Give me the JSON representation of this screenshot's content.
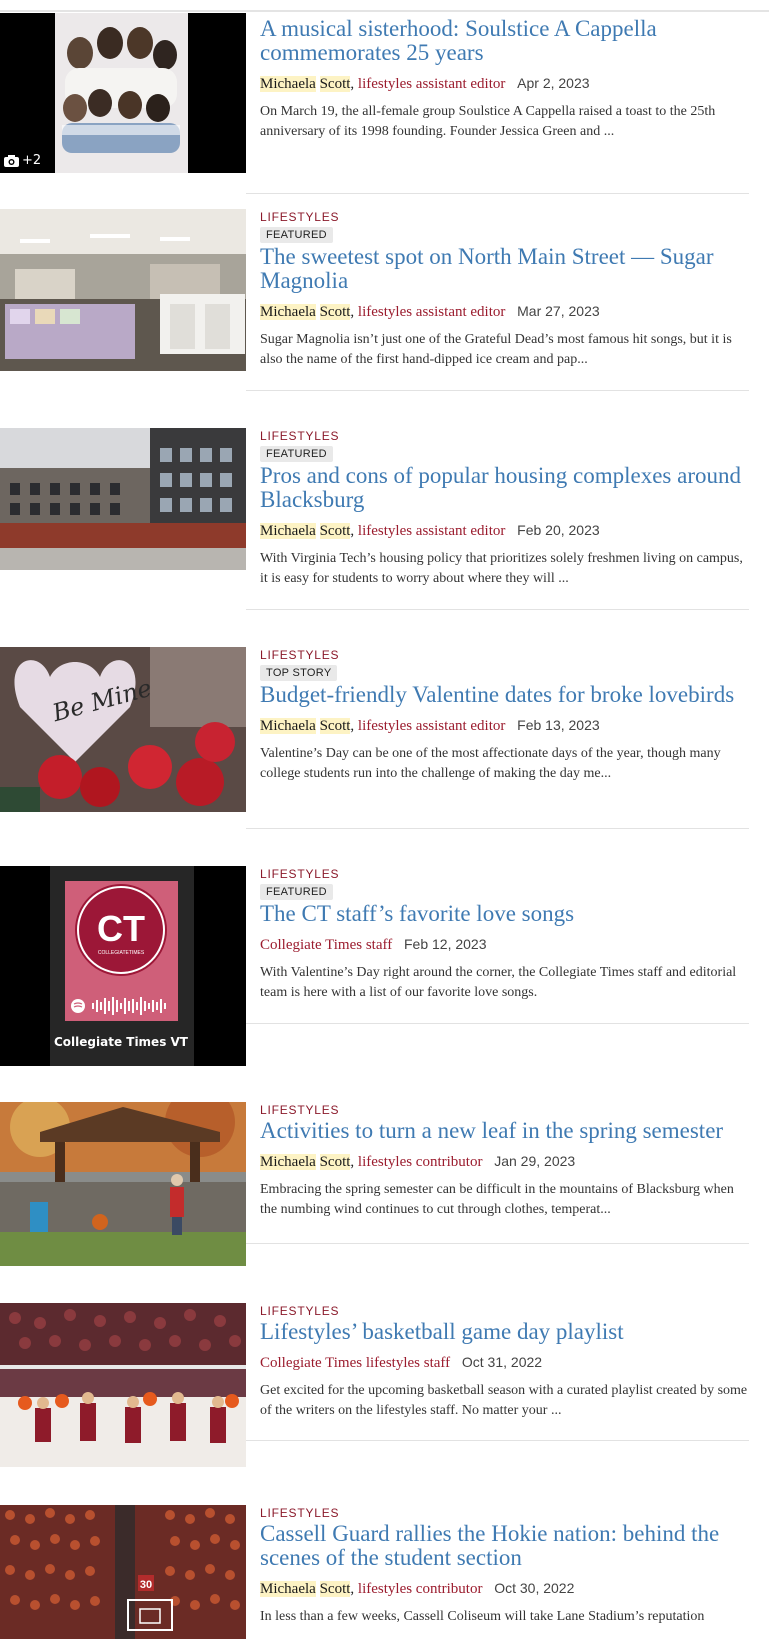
{
  "photo_count": "+2",
  "articles": [
    {
      "section": "",
      "badge": "",
      "headline": "A musical sisterhood: Soulstice A Cappella commemorates 25 years",
      "author_first": "Michaela",
      "author_last": "Scott",
      "author_full": "",
      "role": "lifestyles assistant editor",
      "date": "Apr 2, 2023",
      "excerpt": "On March 19, the all-female group Soulstice A Cappella raised a toast to the 25th anniversary of its 1998 founding. Founder Jessica Green and ..."
    },
    {
      "section": "LIFESTYLES",
      "badge": "FEATURED",
      "headline": "The sweetest spot on North Main Street — Sugar Magnolia",
      "author_first": "Michaela",
      "author_last": "Scott",
      "author_full": "",
      "role": "lifestyles assistant editor",
      "date": "Mar 27, 2023",
      "excerpt": "Sugar Magnolia isn’t just one of the Grateful Dead’s most famous hit songs, but it is also the name of the first hand-dipped ice cream and pap..."
    },
    {
      "section": "LIFESTYLES",
      "badge": "FEATURED",
      "headline": "Pros and cons of popular housing complexes around Blacksburg",
      "author_first": "Michaela",
      "author_last": "Scott",
      "author_full": "",
      "role": "lifestyles assistant editor",
      "date": "Feb 20, 2023",
      "excerpt": "With Virginia Tech’s housing policy that prioritizes solely freshmen living on campus, it is easy for students to worry about where they will ..."
    },
    {
      "section": "LIFESTYLES",
      "badge": "TOP STORY",
      "headline": "Budget-friendly Valentine dates for broke lovebirds",
      "author_first": "Michaela",
      "author_last": "Scott",
      "author_full": "",
      "role": "lifestyles assistant editor",
      "date": "Feb 13, 2023",
      "excerpt": "Valentine’s Day can be one of the most affectionate days of the year, though many college students run into the challenge of making the day me...",
      "image_text": "Be Mine"
    },
    {
      "section": "LIFESTYLES",
      "badge": "FEATURED",
      "headline": "The CT staff’s favorite love songs",
      "author_first": "",
      "author_last": "",
      "author_full": "Collegiate Times staff",
      "role": "",
      "date": "Feb 12, 2023",
      "excerpt": "With Valentine’s Day right around the corner, the Collegiate Times staff and editorial team is here with a list of our favorite love songs.",
      "image_logo": "CT",
      "image_logo_sub": "COLLEGIATETIMES",
      "image_caption": "Collegiate Times VT"
    },
    {
      "section": "LIFESTYLES",
      "badge": "",
      "headline": "Activities to turn a new leaf in the spring semester",
      "author_first": "Michaela",
      "author_last": "Scott",
      "author_full": "",
      "role": "lifestyles contributor",
      "date": "Jan 29, 2023",
      "excerpt": "Embracing the spring semester can be difficult in the mountains of Blacksburg when the numbing wind continues to cut through clothes, temperat..."
    },
    {
      "section": "LIFESTYLES",
      "badge": "",
      "headline": "Lifestyles’ basketball game day playlist",
      "author_first": "",
      "author_last": "",
      "author_full": "Collegiate Times lifestyles staff",
      "role": "",
      "date": "Oct 31, 2022",
      "excerpt": "Get excited for the upcoming basketball season with a curated playlist created by some of the writers on the lifestyles staff. No matter your ..."
    },
    {
      "section": "LIFESTYLES",
      "badge": "",
      "headline": "Cassell Guard rallies the Hokie nation: behind the scenes of the student section",
      "author_first": "Michaela",
      "author_last": "Scott",
      "author_full": "",
      "role": "lifestyles contributor",
      "date": "Oct 30, 2022",
      "excerpt": "In less than a few weeks, Cassell Coliseum will take Lane Stadium’s reputation",
      "image_text": "30"
    }
  ]
}
